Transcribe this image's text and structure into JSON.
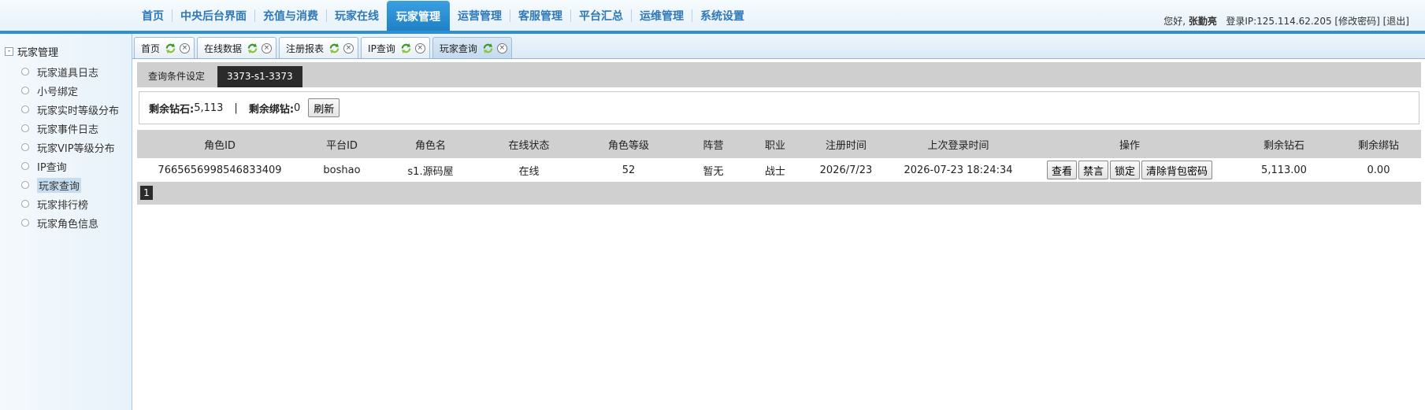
{
  "nav": {
    "items": [
      "首页",
      "中央后台界面",
      "充值与消费",
      "玩家在线",
      "玩家管理",
      "运营管理",
      "客服管理",
      "平台汇总",
      "运维管理",
      "系统设置"
    ],
    "active_index": 4
  },
  "user": {
    "greeting": "您好,",
    "name": "张勤亮",
    "login_ip": "登录IP:125.114.62.205",
    "change_password": "[修改密码]",
    "logout": "[退出]"
  },
  "sidebar": {
    "root_label": "玩家管理",
    "toggle_symbol": "-",
    "items": [
      "玩家道具日志",
      "小号绑定",
      "玩家实时等级分布",
      "玩家事件日志",
      "玩家VIP等级分布",
      "IP查询",
      "玩家查询",
      "玩家排行榜",
      "玩家角色信息"
    ],
    "selected_index": 6
  },
  "tabs": {
    "items": [
      "首页",
      "在线数据",
      "注册报表",
      "IP查询",
      "玩家查询"
    ],
    "active_index": 4,
    "close_symbol": "×"
  },
  "subtabs": {
    "query_settings": "查询条件设定",
    "server": "3373-s1-3373"
  },
  "summary": {
    "diamond_label": "剩余钻石:",
    "diamond_value": "5,113",
    "separator": "|",
    "bound_label": "剩余绑钻:",
    "bound_value": "0",
    "refresh_button": "刷新"
  },
  "table": {
    "headers": [
      "角色ID",
      "平台ID",
      "角色名",
      "在线状态",
      "角色等级",
      "阵营",
      "职业",
      "注册时间",
      "上次登录时间",
      "操作",
      "剩余钻石",
      "剩余绑钻"
    ],
    "rows": [
      {
        "role_id": "7665656998546833409",
        "platform_id": "boshao",
        "role_name": "s1.源码屋",
        "online_status": "在线",
        "level": "52",
        "faction": "暂无",
        "profession": "战士",
        "register_time": "2026/7/23",
        "last_login": "2026-07-23 18:24:34",
        "actions": [
          "查看",
          "禁言",
          "锁定",
          "清除背包密码"
        ],
        "diamonds": "5,113.00",
        "bound_diamonds": "0.00"
      }
    ]
  },
  "pager": {
    "current_page": "1"
  },
  "colors": {
    "nav_active": "#2a8fd6",
    "nav_text": "#2f78b8",
    "topbar_line": "#2f8fd0",
    "header_gray": "#d0d0d0",
    "dark_tab": "#2b2b2b"
  }
}
